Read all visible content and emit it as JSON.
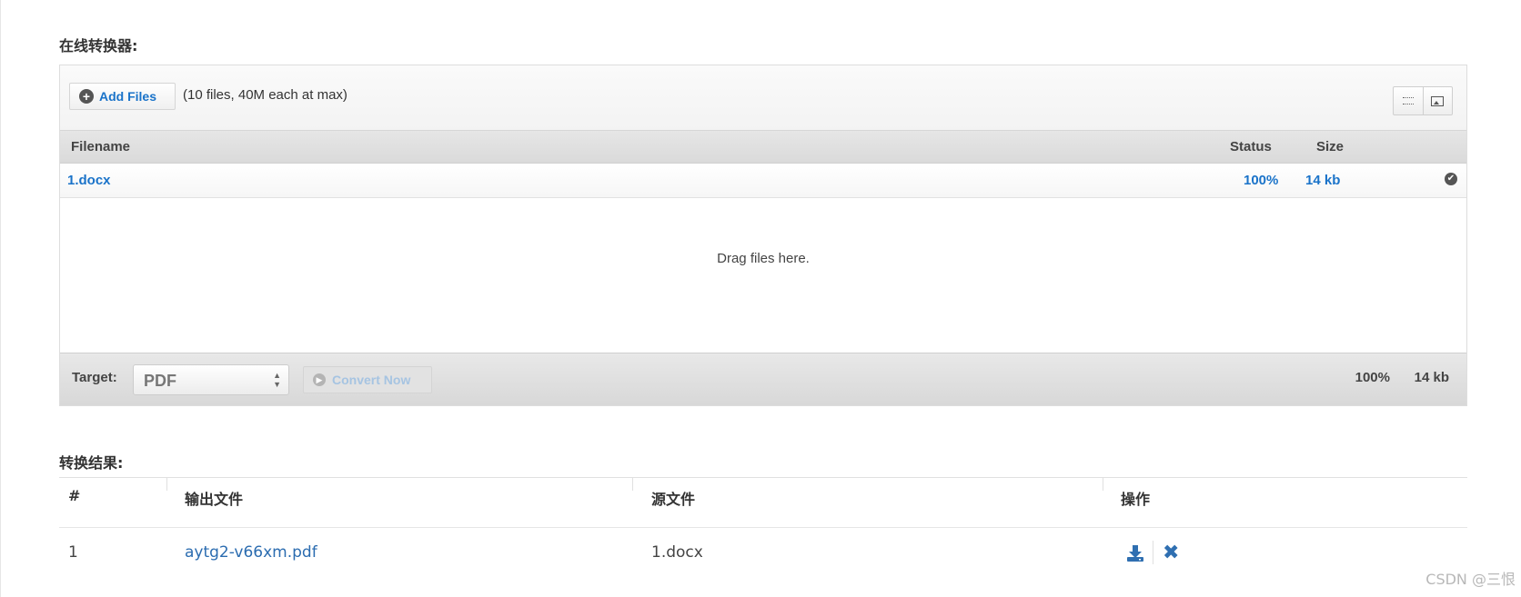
{
  "section_converter_title": "在线转换器:",
  "section_result_title": "转换结果:",
  "uploader": {
    "add_files_label": "Add Files",
    "limit_note": "(10 files, 40M each at max)",
    "columns": {
      "filename": "Filename",
      "status": "Status",
      "size": "Size"
    },
    "files": [
      {
        "name": "1.docx",
        "status": "100%",
        "size": "14 kb"
      }
    ],
    "drop_text": "Drag files here.",
    "footer": {
      "target_label": "Target:",
      "target_value": "PDF",
      "convert_label": "Convert Now",
      "total_status": "100%",
      "total_size": "14 kb"
    }
  },
  "results": {
    "columns": [
      "#",
      "输出文件",
      "源文件",
      "操作"
    ],
    "rows": [
      {
        "index": "1",
        "output": "aytg2-v66xm.pdf",
        "source": "1.docx"
      }
    ]
  },
  "watermark": "CSDN @三恨",
  "colors": {
    "link": "#1a73c9",
    "result_link": "#2b6cb0",
    "icon_blue": "#2f6fb1"
  }
}
